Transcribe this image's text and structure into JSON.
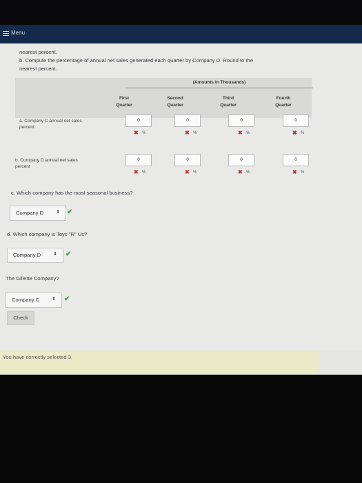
{
  "menu": {
    "label": "Menu"
  },
  "instructions": {
    "line1": "nearest percent.",
    "line2": "b. Compute the percentage of annual net sales generated each quarter by Company D. Round to the",
    "line3": "nearest percent."
  },
  "table": {
    "amounts_header": "(Amounts in Thousands)",
    "columns": [
      {
        "line1": "First",
        "line2": "Quarter"
      },
      {
        "line1": "Second",
        "line2": "Quarter"
      },
      {
        "line1": "Third",
        "line2": "Quarter"
      },
      {
        "line1": "Fourth",
        "line2": "Quarter"
      }
    ],
    "rows": [
      {
        "label1": "a. Company C annual net sales",
        "label2": "percent",
        "values": [
          "0",
          "0",
          "0",
          "0"
        ]
      },
      {
        "label1": "b. Company D annual net sales",
        "label2": "percent",
        "values": [
          "0",
          "0",
          "0",
          "0"
        ]
      }
    ],
    "pct_symbol": "%",
    "x_symbol": "✖"
  },
  "question_c": {
    "text": "c. Which company has the most seasonal business?",
    "answer": "Company D"
  },
  "question_d": {
    "text": "d. Which company is Toys \"R\" Us?",
    "answer": "Company D"
  },
  "question_e": {
    "text": "The Gillette Company?",
    "answer": "Company C"
  },
  "check_button": {
    "label": "Check"
  },
  "feedback": {
    "text": "You have correctly selected 3."
  },
  "symbols": {
    "caret": "⬍",
    "check": "✔"
  }
}
